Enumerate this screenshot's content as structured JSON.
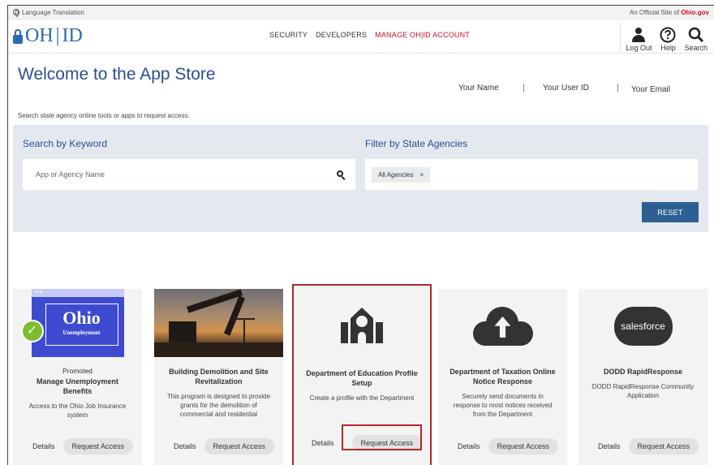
{
  "topstrip": {
    "language_label": "Language Translation",
    "official_prefix": "An Official Site of ",
    "official_brand": "Ohio.gov"
  },
  "header": {
    "logo_left": "OH",
    "logo_sep": "|",
    "logo_right": "ID",
    "nav": [
      "SECURITY",
      "DEVELOPERS",
      "MANAGE OH|ID ACCOUNT"
    ],
    "tools": {
      "logout": "Log Out",
      "help": "Help",
      "search": "Search"
    }
  },
  "welcome": {
    "title": "Welcome to the App Store",
    "subtitle": "Search state agency online tools or apps to request access.",
    "user_name": "Your Name",
    "user_id": "Your User ID",
    "user_email": "Your Email",
    "pipe": "|"
  },
  "search": {
    "keyword_label": "Search by Keyword",
    "keyword_placeholder": "App or Agency Name",
    "filter_label": "Filter by State Agencies",
    "filter_tag": "All Agencies",
    "filter_tag_remove": "×",
    "reset_label": "RESET"
  },
  "cards": [
    {
      "promo": "Promoted",
      "title": "Manage Unemployment Benefits",
      "desc": "Access to the Ohio Job Insurance system",
      "image_text_big": "Ohio",
      "image_text_small": "Unemployment",
      "image_dots": "•••",
      "check": "✓",
      "details": "Details",
      "request": "Request Access"
    },
    {
      "title": "Building Demolition and Site Revitalization",
      "desc": "This program is designed to provide grants for the demolition of commercial and residential",
      "details": "Details",
      "request": "Request Access"
    },
    {
      "title": "Department of Education Profile Setup",
      "desc": "Create a profile with the Department",
      "details": "Details",
      "request": "Request Access"
    },
    {
      "title": "Department of Taxation Online Notice Response",
      "desc": "Securely send documents in response to most notices received from the Department",
      "details": "Details",
      "request": "Request Access"
    },
    {
      "title": "DODD RapidResponse",
      "desc": "DODD RapidResponse Community Application",
      "image_text": "salesforce",
      "details": "Details",
      "request": "Request Access"
    }
  ],
  "colors": {
    "brand_blue": "#2a6bb3",
    "title_blue": "#2a4f8a",
    "nav_active": "#c8102e",
    "reset_bg": "#2d5f93",
    "highlight": "#b3262d"
  },
  "icons": [
    "globe-icon",
    "lock-icon",
    "user-icon",
    "help-icon",
    "search-icon",
    "school-icon",
    "cloud-upload-icon",
    "salesforce-icon",
    "check-icon"
  ]
}
